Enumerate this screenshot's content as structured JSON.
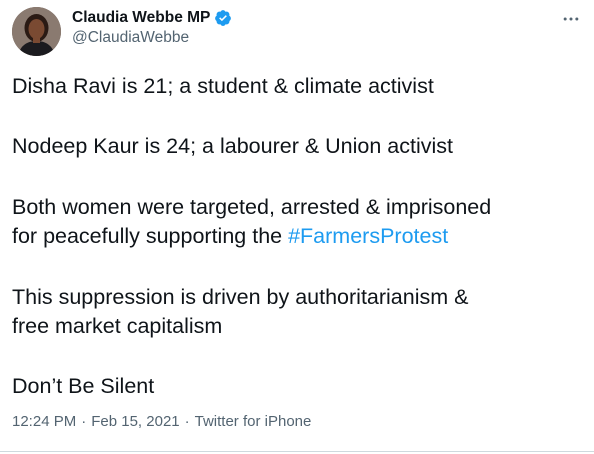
{
  "author": {
    "display_name": "Claudia Webbe MP",
    "handle": "@ClaudiaWebbe",
    "verified": true,
    "avatar_icon": "profile-photo"
  },
  "tweet": {
    "line1": "Disha Ravi is 21; a student & climate activist",
    "line2": "Nodeep Kaur is 24; a labourer &  Union activist",
    "line3a": "Both women were targeted, arrested & imprisoned",
    "line3b": "for peacefully supporting the ",
    "hashtag": "#FarmersProtest",
    "line4a": "This suppression is driven by authoritarianism &",
    "line4b": "free market capitalism",
    "line5": "Don’t Be Silent"
  },
  "meta": {
    "time": "12:24 PM",
    "date": "Feb 15, 2021",
    "source": "Twitter for iPhone",
    "separator": "·"
  },
  "colors": {
    "link": "#1d9bf0",
    "verified": "#1d9bf0",
    "secondary_text": "#536471",
    "primary_text": "#0f1419"
  }
}
